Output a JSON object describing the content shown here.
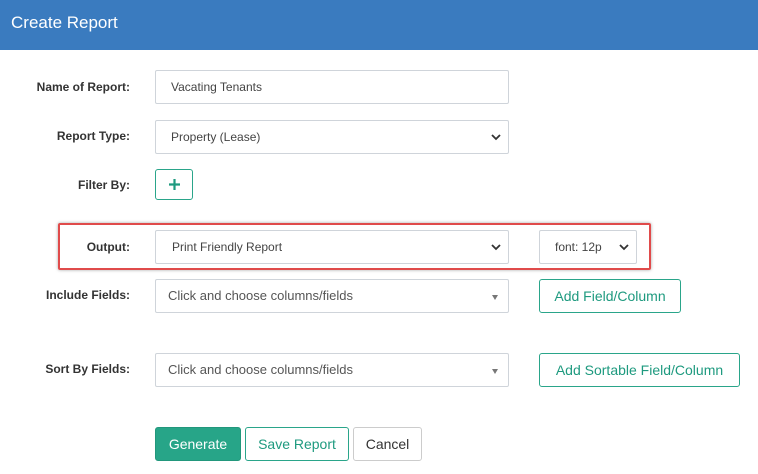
{
  "header": {
    "title": "Create Report"
  },
  "form": {
    "name_label": "Name of Report:",
    "name_value": "Vacating Tenants",
    "type_label": "Report Type:",
    "type_value": "Property (Lease)",
    "filter_label": "Filter By:",
    "output_label": "Output:",
    "output_value": "Print Friendly Report",
    "font_value": "font: 12p",
    "include_label": "Include Fields:",
    "include_placeholder": "Click and choose columns/fields",
    "add_field_label": "Add Field/Column",
    "sort_label": "Sort By Fields:",
    "sort_placeholder": "Click and choose columns/fields",
    "add_sortable_label": "Add Sortable Field/Column"
  },
  "actions": {
    "generate": "Generate",
    "save": "Save Report",
    "cancel": "Cancel"
  },
  "colors": {
    "header_bg": "#3a7bbf",
    "accent": "#27a588",
    "highlight": "#e04b4b"
  }
}
